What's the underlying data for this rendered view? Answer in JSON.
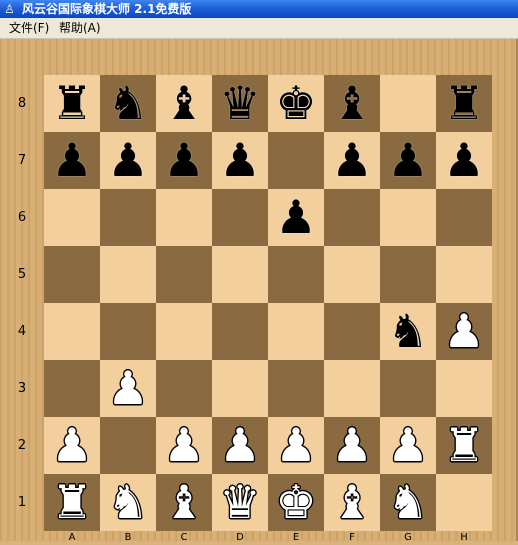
{
  "window": {
    "title": "风云谷国际象棋大师 2.1免费版",
    "app_icon": "chess-pawn-app-icon"
  },
  "menu": {
    "file_label": "文件(F)",
    "help_label": "帮助(A)"
  },
  "board": {
    "ranks": [
      "8",
      "7",
      "6",
      "5",
      "4",
      "3",
      "2",
      "1"
    ],
    "files": [
      "A",
      "B",
      "C",
      "D",
      "E",
      "F",
      "G",
      "H"
    ],
    "colors": {
      "light": "#f2cf9c",
      "dark": "#8a6a40",
      "frame": "#d6ad72"
    },
    "position": [
      [
        "bR",
        "bN",
        "bB",
        "bQ",
        "bK",
        "bB",
        "",
        "bR"
      ],
      [
        "bP",
        "bP",
        "bP",
        "bP",
        "",
        "bP",
        "bP",
        "bP"
      ],
      [
        "",
        "",
        "",
        "",
        "bP",
        "",
        "",
        ""
      ],
      [
        "",
        "",
        "",
        "",
        "",
        "",
        "",
        ""
      ],
      [
        "",
        "",
        "",
        "",
        "",
        "",
        "bN",
        "wP"
      ],
      [
        "",
        "wP",
        "",
        "",
        "",
        "",
        "",
        ""
      ],
      [
        "wP",
        "",
        "wP",
        "wP",
        "wP",
        "wP",
        "wP",
        "wR"
      ],
      [
        "wR",
        "wN",
        "wB",
        "wQ",
        "wK",
        "wB",
        "wN",
        ""
      ]
    ]
  }
}
